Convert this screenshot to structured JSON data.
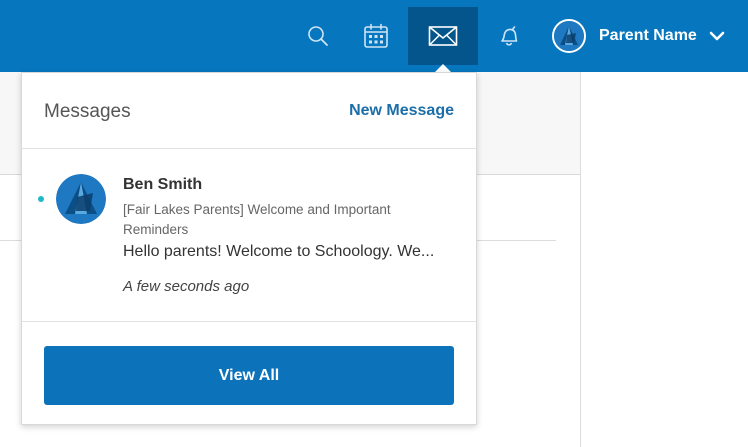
{
  "header": {
    "icons": [
      {
        "name": "search-icon"
      },
      {
        "name": "calendar-icon"
      },
      {
        "name": "mail-icon",
        "active": true
      },
      {
        "name": "bell-icon"
      }
    ],
    "user": {
      "name": "Parent Name",
      "avatar_icon": "school-logo-avatar",
      "menu_icon": "chevron-down-icon"
    }
  },
  "messages_dropdown": {
    "title": "Messages",
    "new_message_label": "New Message",
    "items": [
      {
        "sender": "Ben Smith",
        "subject": "[Fair Lakes Parents] Welcome and Important Reminders",
        "preview": "Hello parents! Welcome to Schoology. We...",
        "time": "A few seconds ago",
        "unread": true,
        "avatar_icon": "school-logo-avatar"
      }
    ],
    "view_all_label": "View All"
  },
  "colors": {
    "topbar": "#0677bf",
    "active_nav": "#04558c",
    "link": "#1c6ea8",
    "button": "#0c73bb",
    "unread_dot": "#20b8c8"
  }
}
